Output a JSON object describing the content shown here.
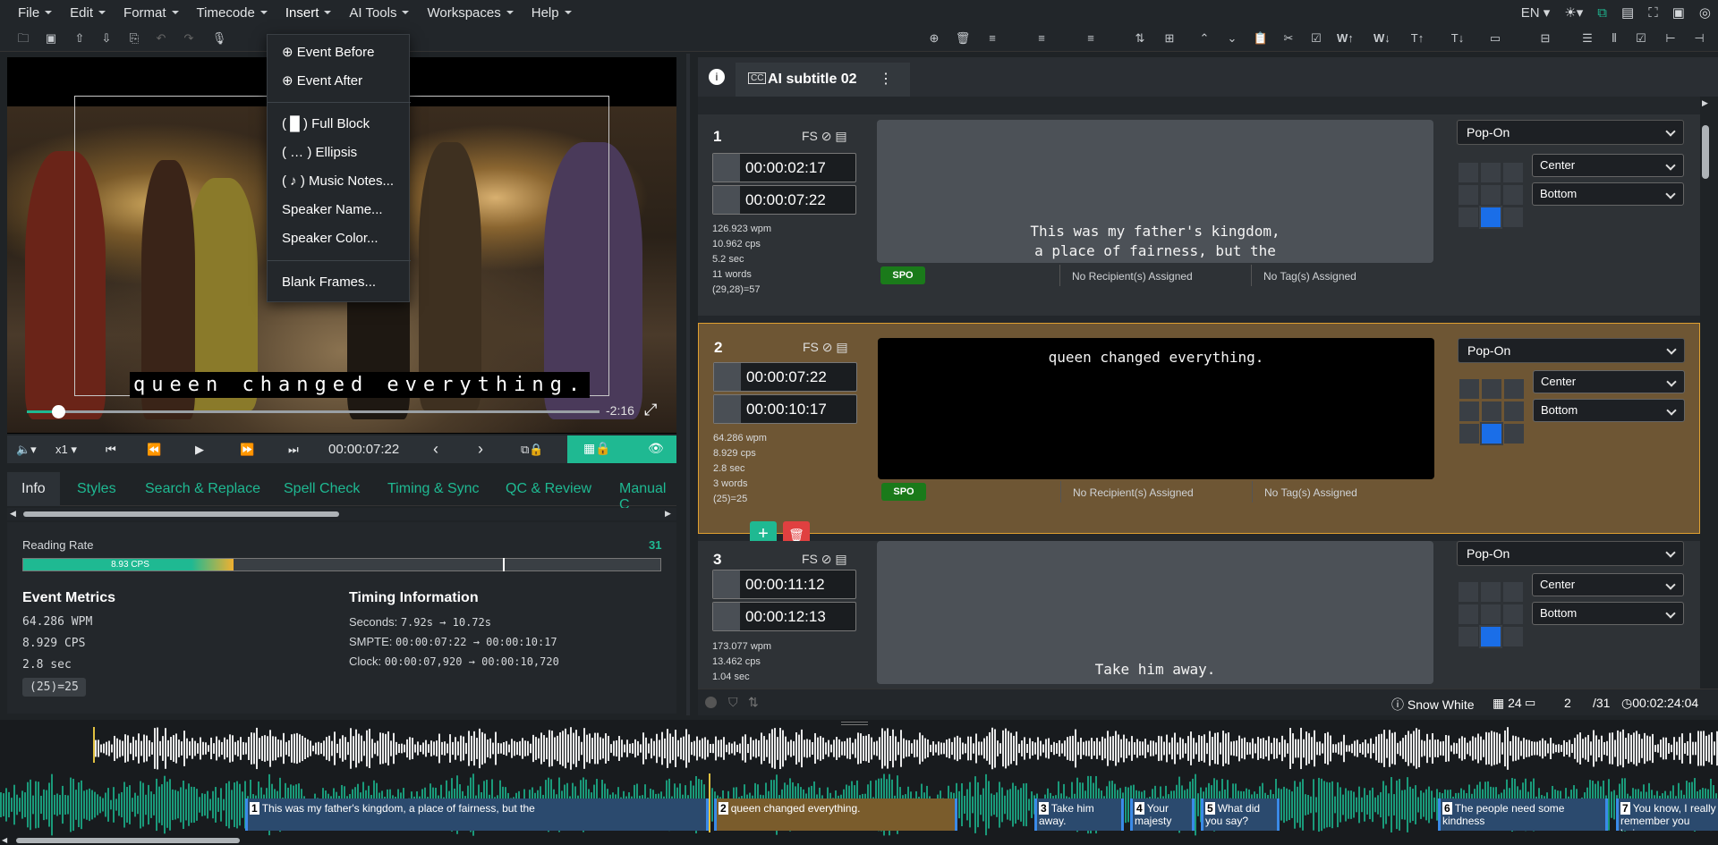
{
  "menubar": {
    "items": [
      "File",
      "Edit",
      "Format",
      "Timecode",
      "Insert",
      "AI Tools",
      "Workspaces",
      "Help"
    ],
    "lang": "EN"
  },
  "insert_menu": {
    "event_before": "Event Before",
    "event_after": "Event After",
    "full_block": "( █ ) Full Block",
    "ellipsis": "( … ) Ellipsis",
    "music_notes": "( ♪ ) Music Notes...",
    "speaker_name": "Speaker Name...",
    "speaker_color": "Speaker Color...",
    "blank_frames": "Blank Frames..."
  },
  "video": {
    "caption": "queen changed everything.",
    "remaining": "-2:16",
    "progress": 0.055
  },
  "player": {
    "speed": "x1",
    "timecode": "00:00:07:22"
  },
  "tabs": [
    "Info",
    "Styles",
    "Search & Replace",
    "Spell Check",
    "Timing & Sync",
    "QC & Review",
    "Manual C"
  ],
  "info": {
    "reading_rate_label": "Reading Rate",
    "reading_rate_max": "31",
    "reading_rate_value": "8.93 CPS",
    "reading_rate_fraction": 0.33,
    "event_metrics_title": "Event Metrics",
    "wpm": "64.286 WPM",
    "cps": "8.929 CPS",
    "duration": "2.8 sec",
    "count": "(25)=25",
    "timing_title": "Timing Information",
    "seconds_label": "Seconds:",
    "seconds_value": "7.92s → 10.72s",
    "smpte_label": "SMPTE:",
    "smpte_value": "00:00:07:22 → 00:00:10:17",
    "clock_label": "Clock:",
    "clock_value": "00:00:07,920 → 00:00:10,720"
  },
  "subtitle_tab": {
    "label": "AI subtitle 02",
    "cc": "CC"
  },
  "events": [
    {
      "num": "1",
      "fs": "FS",
      "start": "00:00:02:17",
      "end": "00:00:07:22",
      "wpm": "126.923 wpm",
      "cps": "10.962 cps",
      "sec": "5.2 sec",
      "words": "11 words",
      "count": "(29,28)=57",
      "text1": "This was my father's kingdom,",
      "text2": "a place of fairness, but the",
      "tag": "SPO",
      "recipients": "No Recipient(s) Assigned",
      "tags": "No Tag(s) Assigned",
      "mode": "Pop-On",
      "align": "Center",
      "vpos": "Bottom"
    },
    {
      "num": "2",
      "fs": "FS",
      "start": "00:00:07:22",
      "end": "00:00:10:17",
      "wpm": "64.286 wpm",
      "cps": "8.929 cps",
      "sec": "2.8 sec",
      "words": "3 words",
      "count": "(25)=25",
      "text1": "queen changed everything.",
      "tag": "SPO",
      "recipients": "No Recipient(s) Assigned",
      "tags": "No Tag(s) Assigned",
      "mode": "Pop-On",
      "align": "Center",
      "vpos": "Bottom"
    },
    {
      "num": "3",
      "fs": "FS",
      "start": "00:00:11:12",
      "end": "00:00:12:13",
      "wpm": "173.077 wpm",
      "cps": "13.462 cps",
      "sec": "1.04 sec",
      "text1": "Take him away.",
      "mode": "Pop-On",
      "align": "Center",
      "vpos": "Bottom"
    }
  ],
  "status": {
    "project": "Snow White",
    "fps": "24",
    "current": "2",
    "total": "/31",
    "duration": "00:02:24:04"
  },
  "timeline": [
    {
      "n": "1",
      "t": "This was my father's kingdom, a place of fairness, but the"
    },
    {
      "n": "2",
      "t": "queen changed everything."
    },
    {
      "n": "3",
      "t": "Take him away."
    },
    {
      "n": "4",
      "t": "Your majesty"
    },
    {
      "n": "5",
      "t": "What did you say?"
    },
    {
      "n": "6",
      "t": "The people need some kindness"
    },
    {
      "n": "7",
      "t": "You know, I really remember you being"
    }
  ],
  "colors": {
    "accent": "#1fb992",
    "selected_event": "#6e5634",
    "delete": "#e04040",
    "spo": "#1a7a1a"
  }
}
